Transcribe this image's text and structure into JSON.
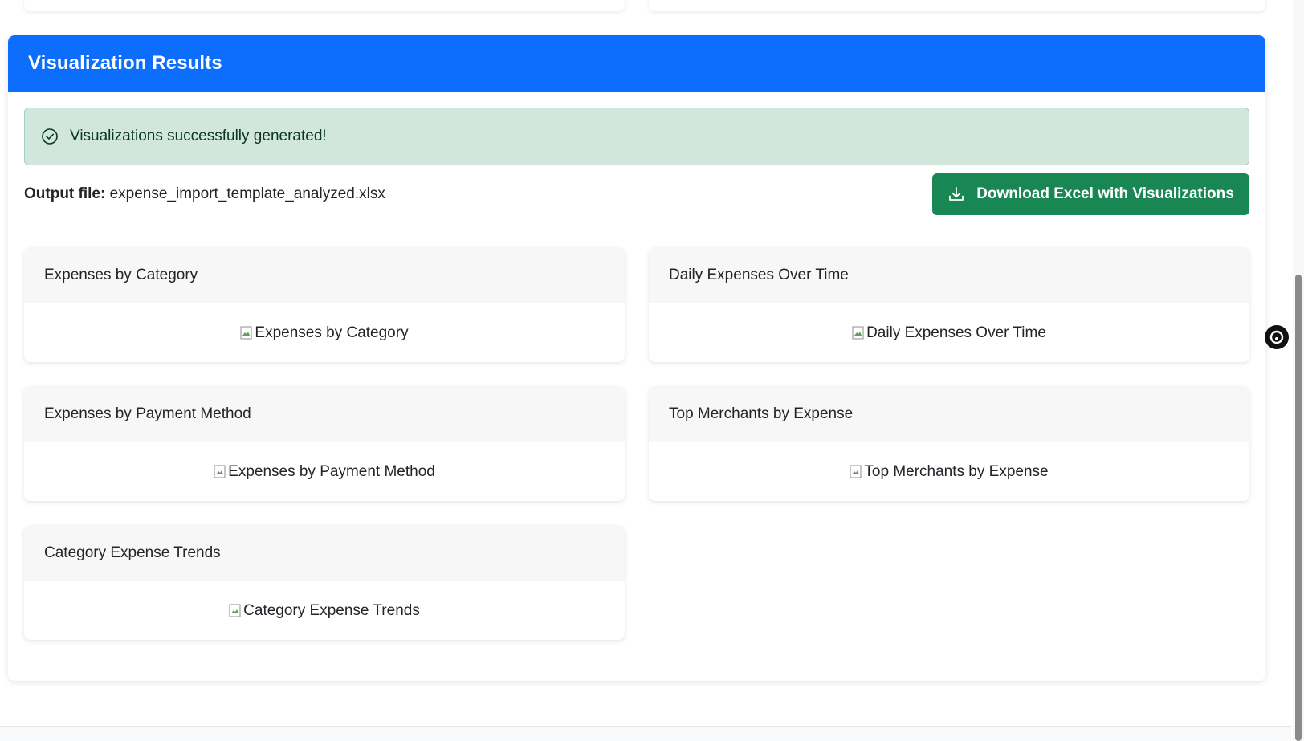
{
  "results": {
    "title": "Visualization Results",
    "alert": {
      "text": "Visualizations successfully generated!",
      "icon": "check-circle-icon"
    },
    "output": {
      "label": "Output file:",
      "filename": "expense_import_template_analyzed.xlsx"
    },
    "download_button": {
      "label": "Download Excel with Visualizations",
      "icon": "download-icon"
    },
    "visualizations": [
      {
        "title": "Expenses by Category",
        "alt": "Expenses by Category"
      },
      {
        "title": "Daily Expenses Over Time",
        "alt": "Daily Expenses Over Time"
      },
      {
        "title": "Expenses by Payment Method",
        "alt": "Expenses by Payment Method"
      },
      {
        "title": "Top Merchants by Expense",
        "alt": "Top Merchants by Expense"
      },
      {
        "title": "Category Expense Trends",
        "alt": "Category Expense Trends"
      }
    ]
  },
  "colors": {
    "primary": "#0d6efd",
    "success": "#198754",
    "alert_bg": "#d1e7dd",
    "alert_border": "#a3cfbb",
    "card_header_bg": "#f7f7f7"
  }
}
